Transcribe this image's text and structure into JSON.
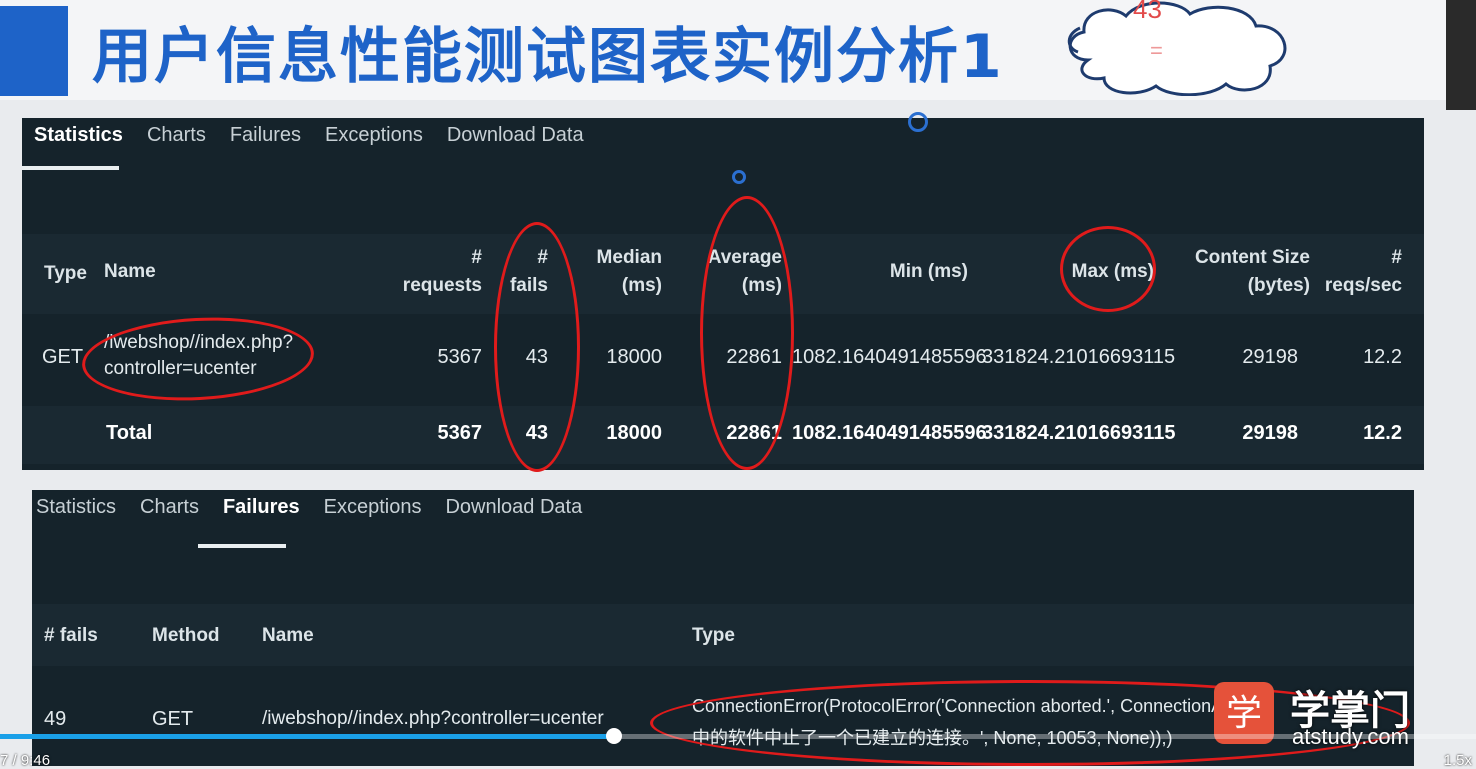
{
  "slide": {
    "title": "用户信息性能测试图表实例分析1",
    "cloud_text_1": "43",
    "cloud_text_2": "="
  },
  "stats_panel": {
    "tabs": [
      {
        "label": "Statistics",
        "active": true
      },
      {
        "label": "Charts",
        "active": false
      },
      {
        "label": "Failures",
        "active": false
      },
      {
        "label": "Exceptions",
        "active": false
      },
      {
        "label": "Download Data",
        "active": false
      }
    ],
    "headers": {
      "type": "Type",
      "name": "Name",
      "requests": [
        "#",
        "requests"
      ],
      "fails": [
        "#",
        "fails"
      ],
      "median": [
        "Median",
        "(ms)"
      ],
      "average": [
        "Average",
        "(ms)"
      ],
      "min": "Min (ms)",
      "max": "Max (ms)",
      "content_size": [
        "Content Size",
        "(bytes)"
      ],
      "rps": [
        "#",
        "reqs/sec"
      ]
    },
    "rows": [
      {
        "type": "GET",
        "name_line1": "/iwebshop//index.php?",
        "name_line2": "controller=ucenter",
        "requests": "5367",
        "fails": "43",
        "median": "18000",
        "average": "22861",
        "min": "1082.1640491485596",
        "max": "331824.21016693115",
        "content_size": "29198",
        "rps": "12.2"
      }
    ],
    "total": {
      "label": "Total",
      "requests": "5367",
      "fails": "43",
      "median": "18000",
      "average": "22861",
      "min": "1082.1640491485596",
      "max": "331824.21016693115",
      "content_size": "29198",
      "rps": "12.2"
    }
  },
  "failures_panel": {
    "tabs": [
      {
        "label": "Statistics",
        "active": false
      },
      {
        "label": "Charts",
        "active": false
      },
      {
        "label": "Failures",
        "active": true
      },
      {
        "label": "Exceptions",
        "active": false
      },
      {
        "label": "Download Data",
        "active": false
      }
    ],
    "headers": {
      "fails": "# fails",
      "method": "Method",
      "name": "Name",
      "type": "Type"
    },
    "rows": [
      {
        "fails": "49",
        "method": "GET",
        "name": "/iwebshop//index.php?controller=ucenter",
        "type_line1": "ConnectionError(ProtocolError('Connection aborted.', ConnectionAbort",
        "type_line2": "中的软件中止了一个已建立的连接。', None, 10053, None)),)"
      }
    ]
  },
  "watermark": {
    "icon_char": "学",
    "name": "学掌门",
    "site": "atstudy.com"
  },
  "player": {
    "progress": 0.416,
    "time": "7 / 9:46",
    "speed": "1.5x",
    "colors": {
      "progress": "#1aa0e8",
      "accent_ring": "#e01b1b"
    }
  }
}
